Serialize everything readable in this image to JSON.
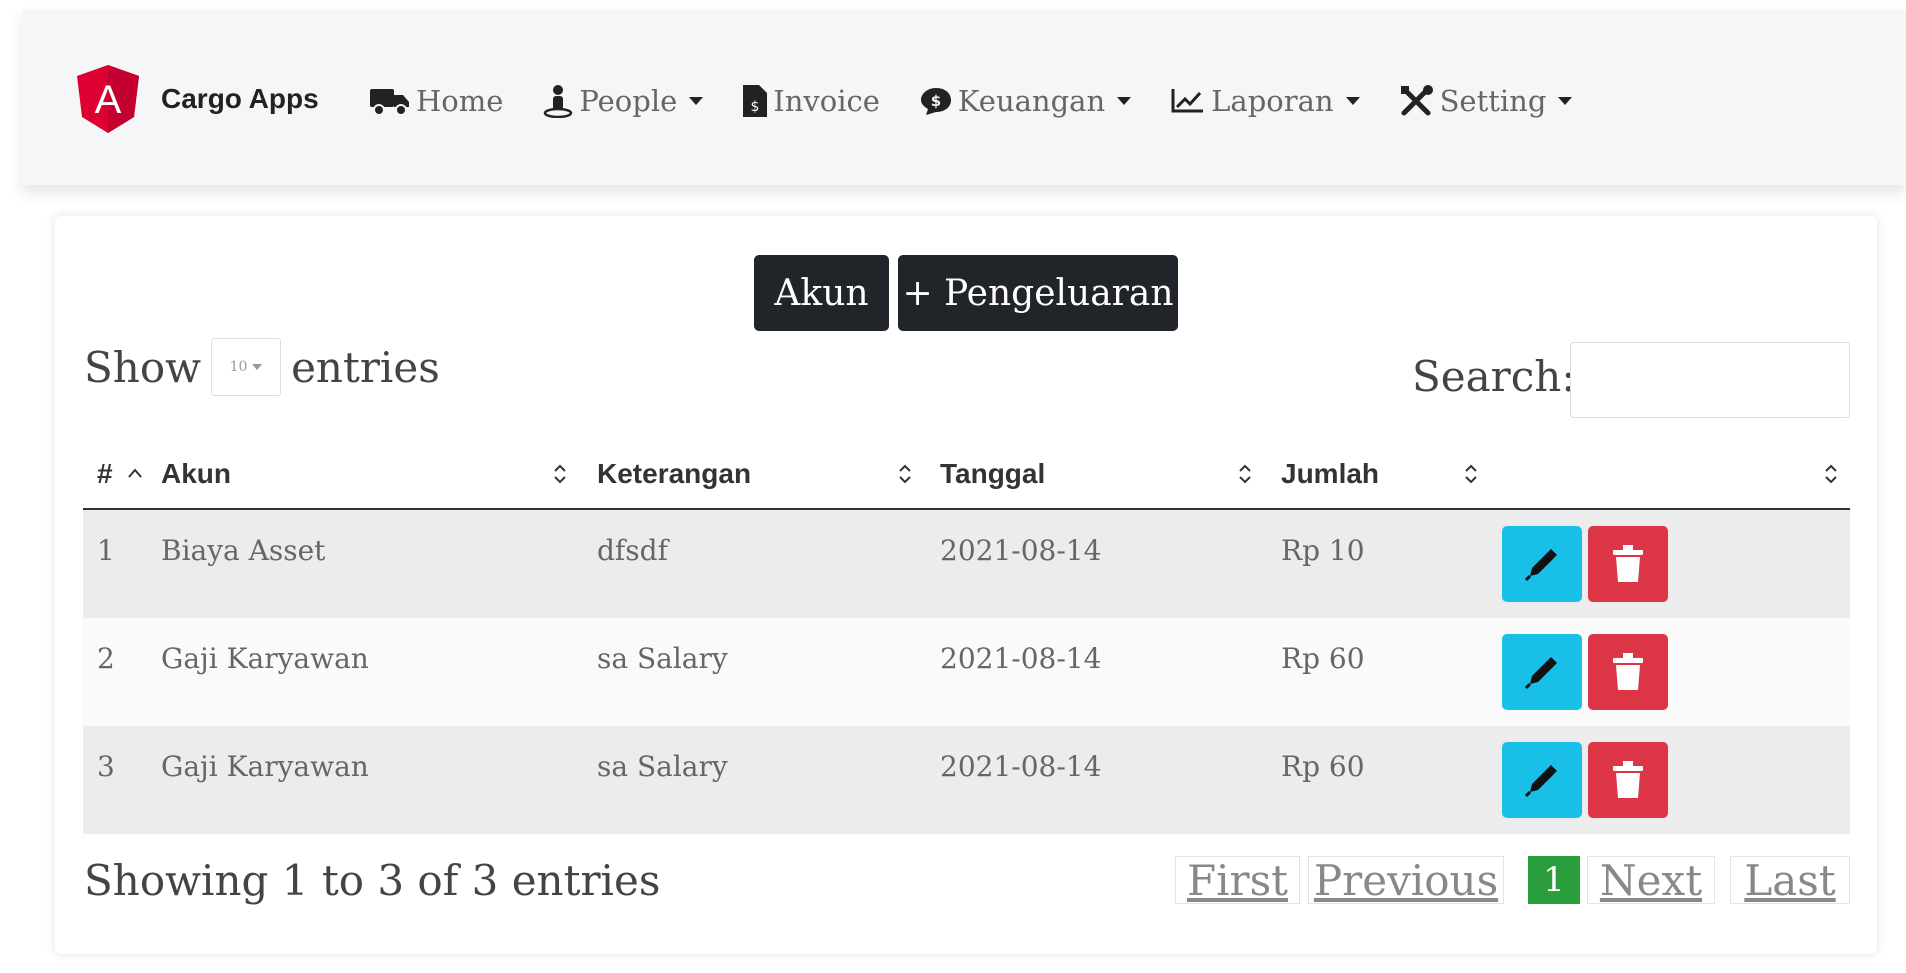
{
  "brand": {
    "name": "Cargo Apps",
    "logo_letter": "A",
    "logo_color": "#dd0031"
  },
  "nav": [
    {
      "label": "Home",
      "icon": "truck-icon",
      "dropdown": false
    },
    {
      "label": "People",
      "icon": "person-icon",
      "dropdown": true
    },
    {
      "label": "Invoice",
      "icon": "invoice-icon",
      "dropdown": false
    },
    {
      "label": "Keuangan",
      "icon": "money-icon",
      "dropdown": true
    },
    {
      "label": "Laporan",
      "icon": "chart-line-icon",
      "dropdown": true
    },
    {
      "label": "Setting",
      "icon": "tools-icon",
      "dropdown": true
    }
  ],
  "actions": {
    "akun": "Akun",
    "pengeluaran": "+ Pengeluaran"
  },
  "length_menu": {
    "show": "Show",
    "value": "10",
    "entries": "entries"
  },
  "search": {
    "label": "Search:",
    "value": ""
  },
  "table": {
    "headers": [
      "#",
      "Akun",
      "Keterangan",
      "Tanggal",
      "Jumlah",
      ""
    ],
    "rows": [
      {
        "no": "1",
        "akun": "Biaya Asset",
        "keterangan": "dfsdf",
        "tanggal": "2021-08-14",
        "jumlah": "Rp 10"
      },
      {
        "no": "2",
        "akun": "Gaji Karyawan",
        "keterangan": "sa Salary",
        "tanggal": "2021-08-14",
        "jumlah": "Rp 60"
      },
      {
        "no": "3",
        "akun": "Gaji Karyawan",
        "keterangan": "sa Salary",
        "tanggal": "2021-08-14",
        "jumlah": "Rp 60"
      }
    ]
  },
  "info": "Showing 1 to 3 of 3 entries",
  "pagination": {
    "first": "First",
    "previous": "Previous",
    "current": "1",
    "next": "Next",
    "last": "Last"
  },
  "colors": {
    "edit": "#18bfe6",
    "delete": "#dc3545",
    "active_page": "#2a9d3c",
    "dark_button": "#212529"
  }
}
